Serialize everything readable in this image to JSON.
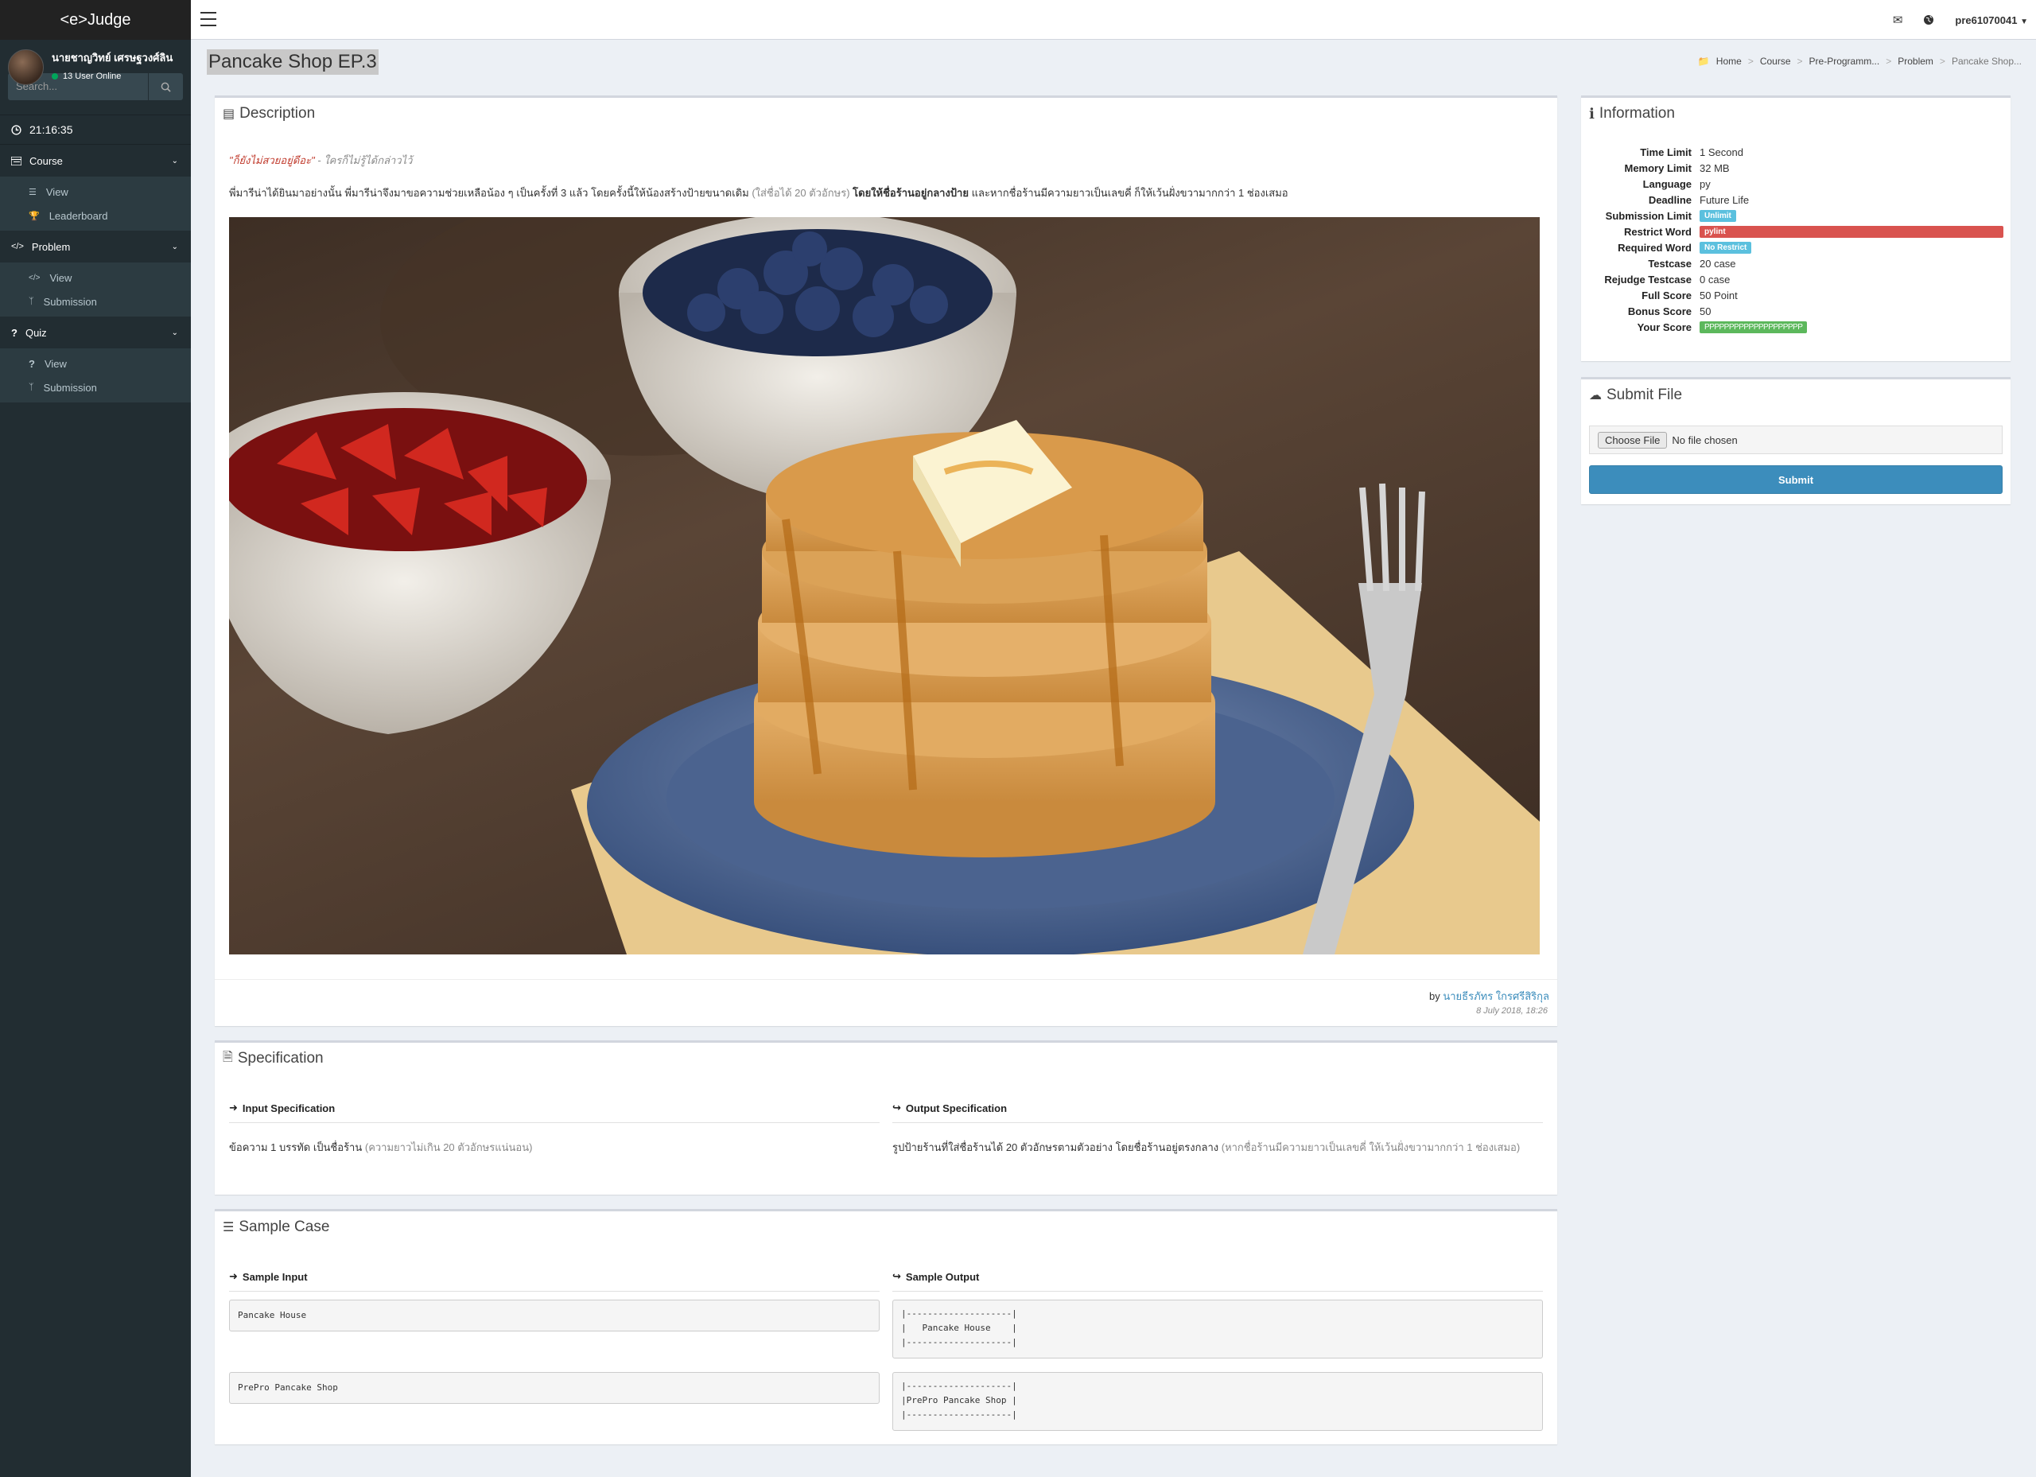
{
  "app": {
    "logo": "<e>Judge"
  },
  "user": {
    "name": "นายชาญวิทย์ เศรษฐวงศ์ลิน",
    "online": "13 User Online",
    "username": "pre61070041"
  },
  "sidebar": {
    "search_placeholder": "Search...",
    "clock": "21:16:35",
    "menus": [
      {
        "label": "Course",
        "items": [
          {
            "label": "View"
          },
          {
            "label": "Leaderboard"
          }
        ]
      },
      {
        "label": "Problem",
        "items": [
          {
            "label": "View"
          },
          {
            "label": "Submission"
          }
        ]
      },
      {
        "label": "Quiz",
        "items": [
          {
            "label": "View"
          },
          {
            "label": "Submission"
          }
        ]
      }
    ]
  },
  "page": {
    "title": "Pancake Shop EP.3"
  },
  "breadcrumb": {
    "home": "Home",
    "course": "Course",
    "program": "Pre-Programm...",
    "problem": "Problem",
    "current": "Pancake Shop..."
  },
  "description": {
    "title": "Description",
    "quote": "\"ก็ยังไม่สวยอยู่ดีอะ\"",
    "quote_author": " - ใครก็ไม่รู้ได้กล่าวไว้",
    "text1": "พี่มารีน่าได้ยินมาอย่างนั้น พี่มารีน่าจึงมาขอความช่วยเหลือน้อง ๆ เป็นครั้งที่ 3 แล้ว โดยครั้งนี้ให้น้องสร้างป้ายขนาดเดิม ",
    "text2": "(ใส่ชื่อได้ 20 ตัวอักษร) ",
    "text3": "โดยให้ชื่อร้านอยู่กลางป้าย",
    "text4": " และหากชื่อร้านมีความยาวเป็นเลขคี่ ก็ให้เว้นฝั่งขวามากกว่า 1 ช่องเสมอ",
    "by": "by ",
    "author": "นายธีรภัทร ใกรศรีสิริกุล",
    "date": "8 July 2018, 18:26"
  },
  "information": {
    "title": "Information",
    "rows": [
      {
        "key": "Time Limit",
        "value": "1 Second"
      },
      {
        "key": "Memory Limit",
        "value": "32 MB"
      },
      {
        "key": "Language",
        "value": "py"
      },
      {
        "key": "Deadline",
        "value": "Future Life"
      }
    ],
    "submission_limit_key": "Submission Limit",
    "submission_limit": "Unlimit",
    "restrict_word_key": "Restrict Word",
    "restrict_word": "pylint",
    "required_word_key": "Required Word",
    "required_word": "No Restrict",
    "rows2": [
      {
        "key": "Testcase",
        "value": "20 case"
      },
      {
        "key": "Rejudge Testcase",
        "value": "0 case"
      },
      {
        "key": "Full Score",
        "value": "50 Point"
      },
      {
        "key": "Bonus Score",
        "value": "50"
      }
    ],
    "your_score_key": "Your Score",
    "your_score": "PPPPPPPPPPPPPPPPPPPP",
    "colors": {
      "info": "#5bc0de",
      "danger": "#d9534f",
      "success": "#5cb85c"
    }
  },
  "submit": {
    "title": "Submit File",
    "choose": "Choose File",
    "no_file": "No file chosen",
    "button": "Submit"
  },
  "specification": {
    "title": "Specification",
    "input_head": "Input Specification",
    "input_text": "ข้อความ 1 บรรทัด เป็นชื่อร้าน ",
    "input_note": "(ความยาวไม่เกิน 20 ตัวอักษรแน่นอน)",
    "output_head": "Output Specification",
    "output_text": "รูปป้ายร้านที่ใส่ชื่อร้านได้ 20 ตัวอักษรตามตัวอย่าง โดยชื่อร้านอยู่ตรงกลาง ",
    "output_note": "(หากชื่อร้านมีความยาวเป็นเลขคี่ ให้เว้นฝั่งขวามากกว่า 1 ช่องเสมอ)"
  },
  "samples": {
    "title": "Sample Case",
    "input_head": "Sample Input",
    "output_head": "Sample Output",
    "cases": [
      {
        "input": "Pancake House",
        "output": "|--------------------|\n|   Pancake House    |\n|--------------------|"
      },
      {
        "input": "PrePro Pancake Shop",
        "output": "|--------------------|\n|PrePro Pancake Shop |\n|--------------------|"
      }
    ]
  }
}
